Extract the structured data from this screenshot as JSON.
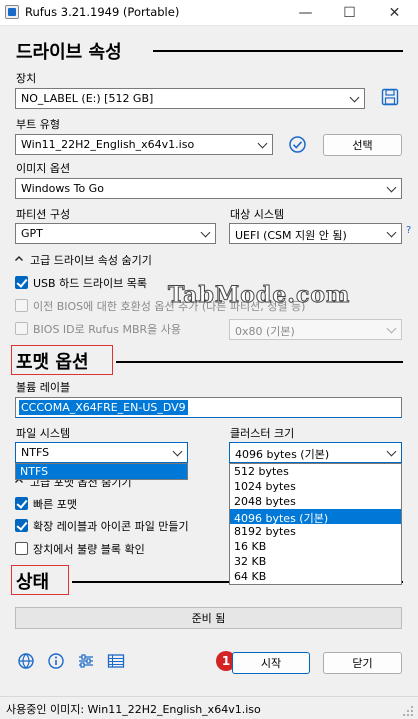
{
  "window": {
    "title": "Rufus 3.21.1949 (Portable)",
    "minimize": "—",
    "maximize": "☐",
    "close": "✕"
  },
  "drive": {
    "heading": "드라이브 속성",
    "device_label": "장치",
    "device_value": "NO_LABEL (E:) [512 GB]",
    "boot_label": "부트 유형",
    "boot_value": "Win11_22H2_English_x64v1.iso",
    "select_button": "선택",
    "image_option_label": "이미지 옵션",
    "image_option_value": "Windows To Go",
    "partition_label": "파티션 구성",
    "partition_value": "GPT",
    "target_label": "대상 시스템",
    "target_value": "UEFI (CSM 지원 안 됨)",
    "help_mark": "?",
    "advanced_toggle": "고급 드라이브 속성 숨기기",
    "usb_hdd_label": "USB 하드 드라이브 목록",
    "bios_compat_label": "이전 BIOS에 대한 호환성 옵션 추가 (다른 파티션, 정렬 등)",
    "bios_id_label": "BIOS ID로 Rufus MBR을 사용",
    "bios_id_value": "0x80 (기본)"
  },
  "format": {
    "heading": "포맷 옵션",
    "volume_label_label": "볼륨 레이블",
    "volume_label_value": "CCCOMA_X64FRE_EN-US_DV9",
    "fs_label": "파일 시스템",
    "fs_value": "NTFS",
    "fs_options": [
      "NTFS"
    ],
    "cluster_label": "클러스터 크기",
    "cluster_value": "4096 bytes (기본)",
    "cluster_options": [
      "512 bytes",
      "1024 bytes",
      "2048 bytes",
      "4096 bytes (기본)",
      "8192 bytes",
      "16 KB",
      "32 KB",
      "64 KB"
    ],
    "cluster_selected_index": 3,
    "advanced_toggle": "고급 포맷 옵션 숨기기",
    "quick_format_label": "빠른 포맷",
    "extended_label": "확장 레이블과 아이콘 파일 만들기",
    "bad_blocks_label": "장치에서 불량 블록 확인"
  },
  "status": {
    "heading": "상태",
    "progress_text": "준비 됨",
    "start_button": "시작",
    "close_button": "닫기",
    "step_badge": "1"
  },
  "statusbar": {
    "text": "사용중인 이미지: Win11_22H2_English_x64v1.iso"
  },
  "watermark": "TabMode.com",
  "colors": {
    "accent": "#0078d7",
    "annotation_red": "#d33"
  }
}
